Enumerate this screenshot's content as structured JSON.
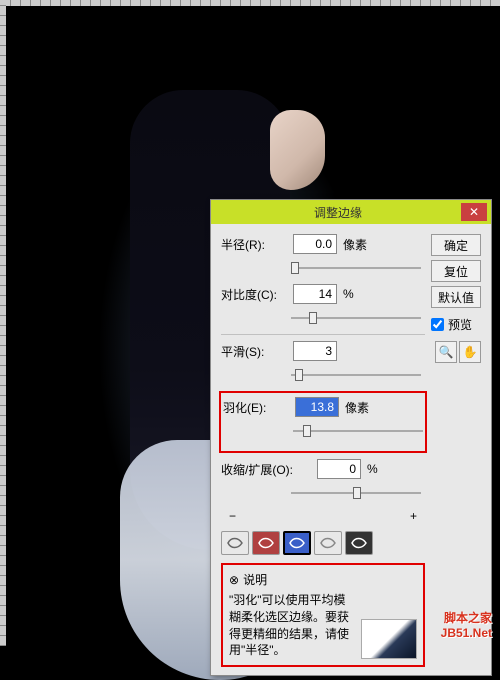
{
  "dialog": {
    "title": "调整边缘",
    "radius": {
      "label": "半径(R):",
      "value": "0.0",
      "unit": "像素"
    },
    "contrast": {
      "label": "对比度(C):",
      "value": "14",
      "unit": "%"
    },
    "smooth": {
      "label": "平滑(S):",
      "value": "3"
    },
    "feather": {
      "label": "羽化(E):",
      "value": "13.8",
      "unit": "像素"
    },
    "shrink": {
      "label": "收缩/扩展(O):",
      "value": "0",
      "unit": "%"
    },
    "minus": "−",
    "plus": "+",
    "desc_head": "说明",
    "desc_text": "\"羽化\"可以使用平均模糊柔化选区边缘。要获得更精细的结果，请使用\"半径\"。"
  },
  "buttons": {
    "ok": "确定",
    "reset": "复位",
    "default": "默认值",
    "preview": "预览"
  },
  "watermark": {
    "l1": "脚本之家",
    "l2": "JB51.Net"
  },
  "icons": {
    "close": "✕",
    "toggle": "⊗",
    "hand": "✋",
    "zoom": "🔍"
  }
}
